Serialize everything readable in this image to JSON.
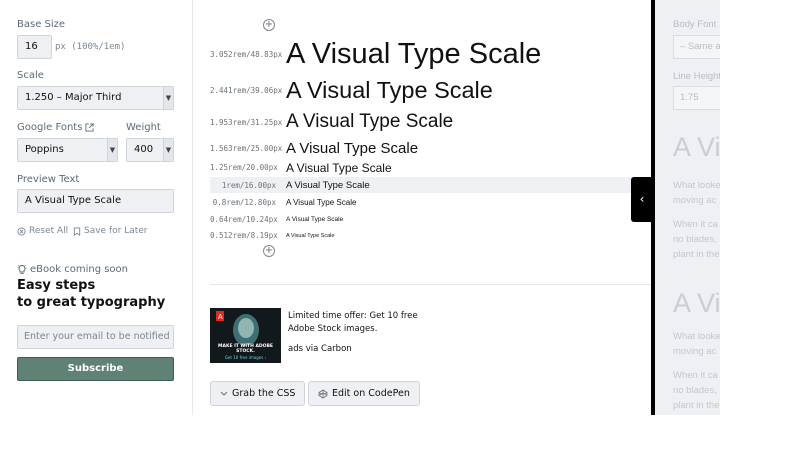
{
  "settings": {
    "base_size_label": "Base Size",
    "base_size_value": "16",
    "base_size_unit": "px (100%/1em)",
    "scale_label": "Scale",
    "scale_value": "1.250 – Major Third",
    "google_fonts_label": "Google Fonts",
    "font_value": "Poppins",
    "weight_label": "Weight",
    "weight_value": "400",
    "preview_text_label": "Preview Text",
    "preview_text_value": "A Visual Type Scale",
    "reset_label": "Reset All",
    "save_label": "Save for Later"
  },
  "ebook": {
    "badge": "eBook coming soon",
    "title_line1": "Easy steps",
    "title_line2": "to great typography",
    "email_placeholder": "Enter your email to be notified",
    "subscribe_label": "Subscribe"
  },
  "scale_rows": [
    {
      "size": "3.052rem/48.83px",
      "sample": "A Visual Type Scale"
    },
    {
      "size": "2.441rem/39.06px",
      "sample": "A Visual Type Scale"
    },
    {
      "size": "1.953rem/31.25px",
      "sample": "A Visual Type Scale"
    },
    {
      "size": "1.563rem/25.00px",
      "sample": "A Visual Type Scale"
    },
    {
      "size": "1.25rem/20.00px",
      "sample": "A Visual Type Scale"
    },
    {
      "size": "1rem/16.00px",
      "sample": "A Visual Type Scale"
    },
    {
      "size": "0.8rem/12.80px",
      "sample": "A Visual Type Scale"
    },
    {
      "size": "0.64rem/10.24px",
      "sample": "A Visual Type Scale"
    },
    {
      "size": "0.512rem/8.19px",
      "sample": "A Visual Type Scale"
    }
  ],
  "ad": {
    "text": "Limited time offer: Get 10 free Adobe Stock images.",
    "via": "ads via Carbon",
    "image_caption": "MAKE IT WITH ADOBE STOCK.",
    "image_sub": "Get 10 free images ›"
  },
  "actions": {
    "grab_css": "Grab the CSS",
    "codepen": "Edit on CodePen"
  },
  "preview_panel": {
    "body_font_label": "Body Font",
    "body_font_value": "– Same as",
    "line_height_label": "Line Height",
    "line_height_value": "1.75",
    "heading": "A Vi",
    "para1": "What looke\nmoving ac",
    "para2": "When it ca\nno blades,\nplant in the",
    "heading2": "A Vis",
    "para3": "What looke\nmoving ac",
    "para4": "When it ca\nno blades,\nplant in the"
  },
  "colors": {
    "accent_button": "#5f8275",
    "divider": "#000000"
  }
}
